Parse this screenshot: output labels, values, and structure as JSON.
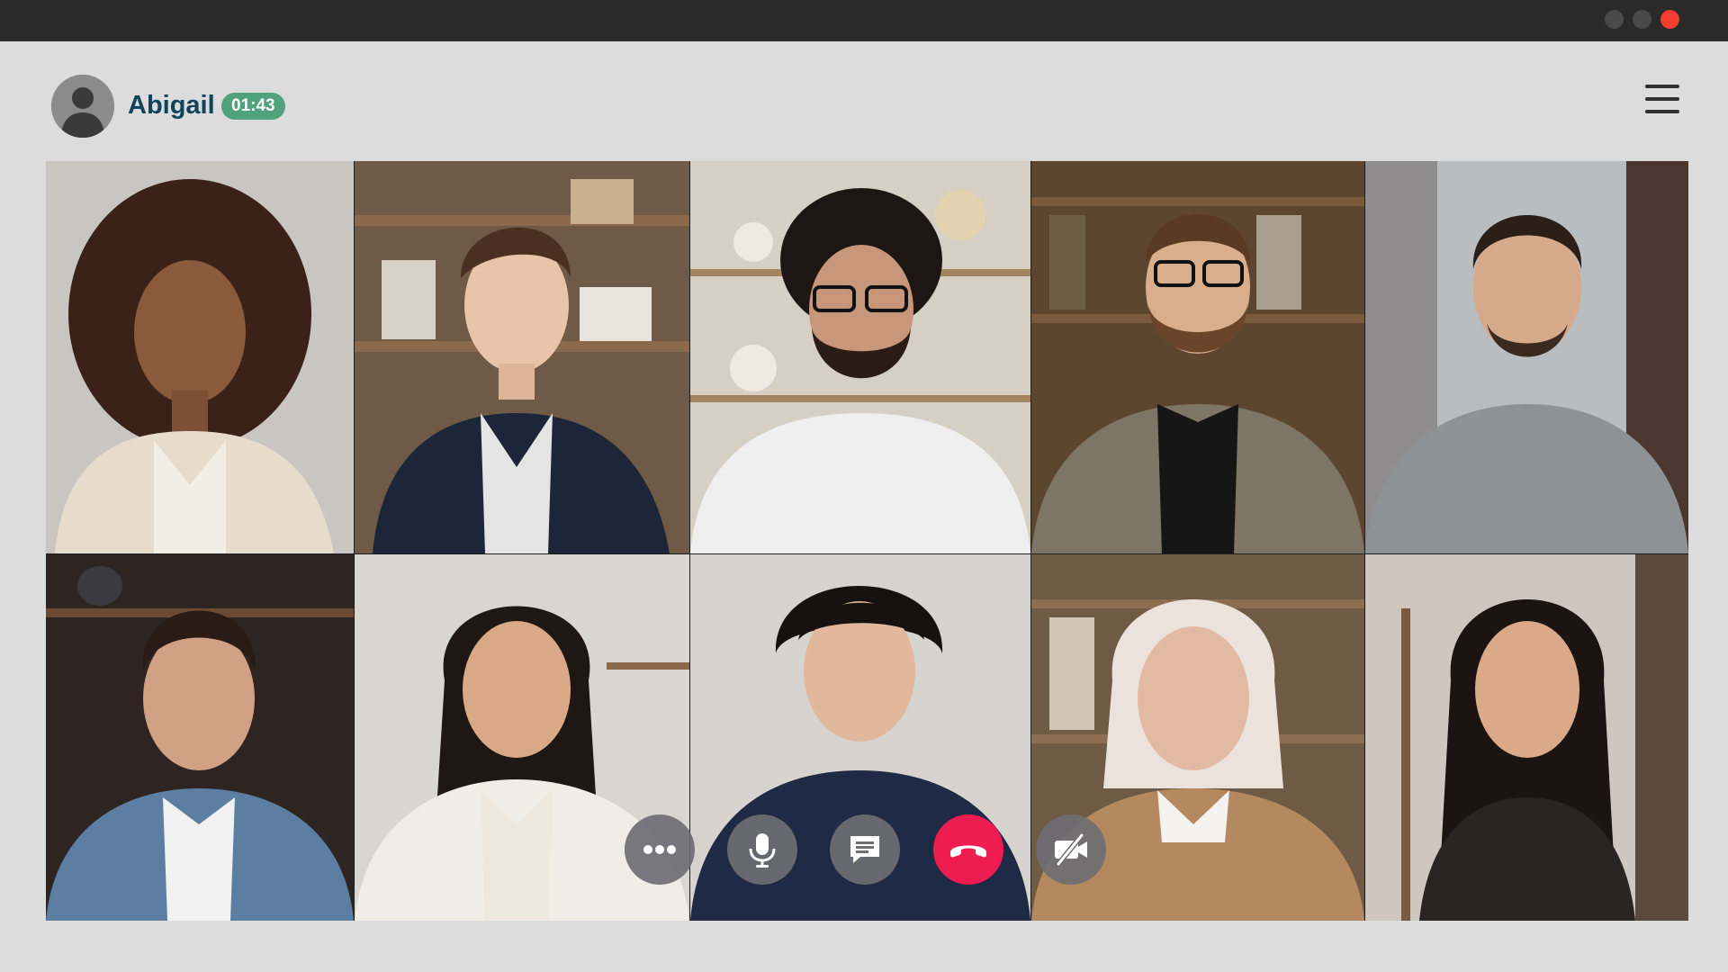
{
  "window": {
    "controls": [
      {
        "name": "minimize",
        "color": "#4a4a4a"
      },
      {
        "name": "maximize",
        "color": "#4a4a4a"
      },
      {
        "name": "close",
        "color": "#f23d30"
      }
    ]
  },
  "header": {
    "caller_name": "Abigail",
    "call_timer": "01:43",
    "avatar_icon": "user-silhouette-icon",
    "menu_icon": "hamburger-menu-icon"
  },
  "participants": [
    {
      "row": 1,
      "col": 1,
      "description_icon": "participant-video"
    },
    {
      "row": 1,
      "col": 2,
      "description_icon": "participant-video"
    },
    {
      "row": 1,
      "col": 3,
      "description_icon": "participant-video"
    },
    {
      "row": 1,
      "col": 4,
      "description_icon": "participant-video"
    },
    {
      "row": 1,
      "col": 5,
      "description_icon": "participant-video"
    },
    {
      "row": 2,
      "col": 1,
      "description_icon": "participant-video"
    },
    {
      "row": 2,
      "col": 2,
      "description_icon": "participant-video"
    },
    {
      "row": 2,
      "col": 3,
      "description_icon": "participant-video"
    },
    {
      "row": 2,
      "col": 4,
      "description_icon": "participant-video"
    },
    {
      "row": 2,
      "col": 5,
      "description_icon": "participant-video"
    }
  ],
  "call_controls": [
    {
      "name": "more-options",
      "icon": "more-horizontal-icon",
      "color": "#6e6e73"
    },
    {
      "name": "microphone",
      "icon": "microphone-icon",
      "color": "#6e6e73"
    },
    {
      "name": "chat",
      "icon": "chat-message-icon",
      "color": "#6e6e73"
    },
    {
      "name": "end-call",
      "icon": "hang-up-phone-icon",
      "color": "#ee1c50"
    },
    {
      "name": "video-off",
      "icon": "video-camera-off-icon",
      "color": "#6e6e73"
    }
  ]
}
